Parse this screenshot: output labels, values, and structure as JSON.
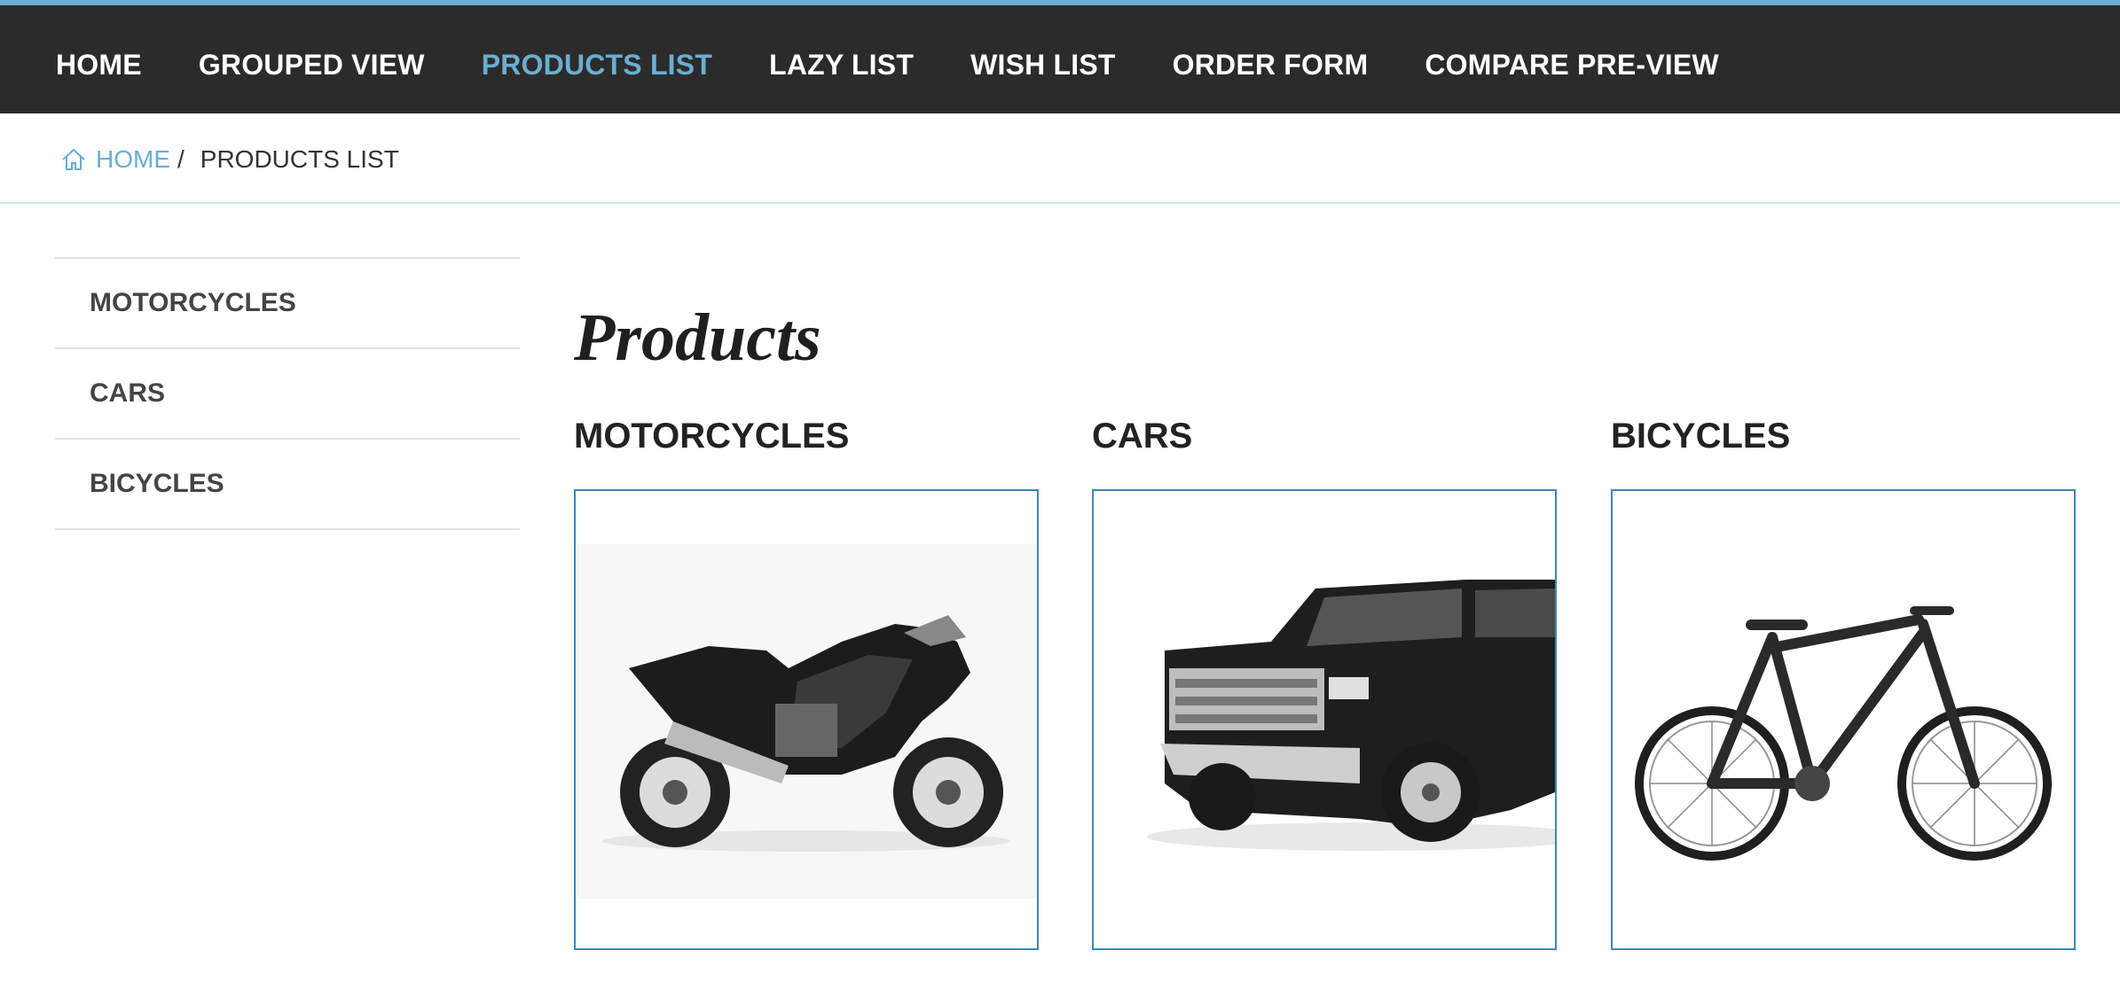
{
  "nav": {
    "items": [
      {
        "label": "HOME"
      },
      {
        "label": "GROUPED VIEW"
      },
      {
        "label": "PRODUCTS LIST",
        "active": true
      },
      {
        "label": "LAZY LIST"
      },
      {
        "label": "WISH LIST"
      },
      {
        "label": "ORDER FORM"
      },
      {
        "label": "COMPARE PRE-VIEW"
      }
    ]
  },
  "breadcrumb": {
    "home_icon": "home-icon",
    "home_label": "HOME",
    "separator": "/",
    "current": "PRODUCTS LIST"
  },
  "sidebar": {
    "items": [
      {
        "label": "MOTORCYCLES"
      },
      {
        "label": "CARS"
      },
      {
        "label": "BICYCLES"
      }
    ]
  },
  "main": {
    "title": "Products",
    "categories": [
      {
        "title": "MOTORCYCLES",
        "image": "motorcycle-image"
      },
      {
        "title": "CARS",
        "image": "pickup-truck-image"
      },
      {
        "title": "BICYCLES",
        "image": "mountain-bike-image"
      }
    ]
  },
  "colors": {
    "accent": "#6aaed1",
    "nav_bg": "#2b2b2b",
    "card_border": "#3d87b4"
  }
}
